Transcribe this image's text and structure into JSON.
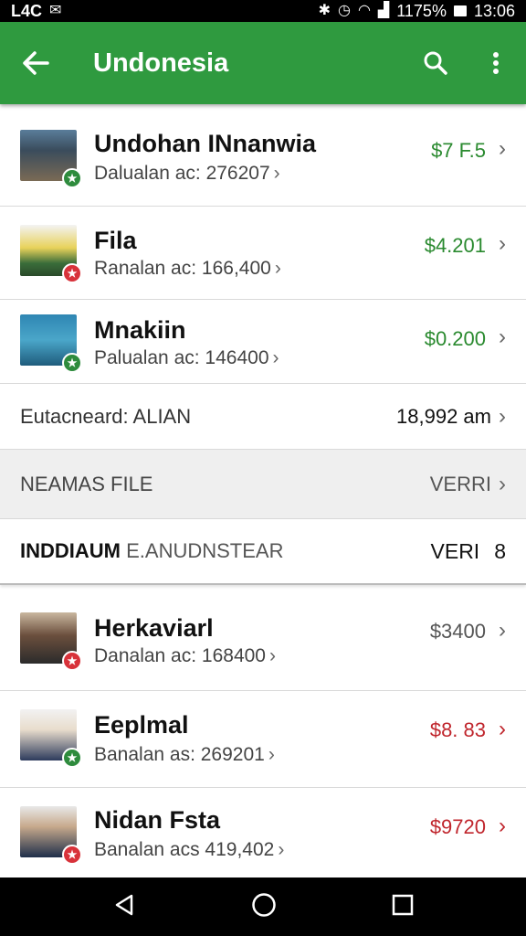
{
  "status_bar": {
    "carrier": "L4C",
    "signal": "1175%",
    "time": "13:06"
  },
  "app_bar": {
    "title": "Undonesia"
  },
  "items_top": [
    {
      "name": "Undohan INnanwia",
      "sub": "Dalualan ac: 276207",
      "price": "$7 F.5",
      "price_color": "#2a8a2f",
      "badge": "green"
    },
    {
      "name": "Fila",
      "sub": "Ranalan ac: 166,400",
      "price": "$4.201",
      "price_color": "#2a8a2f",
      "badge": "red"
    },
    {
      "name": "Mnakiin",
      "sub": "Palualan ac: 146400",
      "price": "$0.200",
      "price_color": "#2a8a2f",
      "badge": "green"
    }
  ],
  "summary_row": {
    "label": "Eutacneard: ALIAN",
    "value": "18,992 am"
  },
  "section1": {
    "label": "NEAMAS FILE",
    "value": "VERRI"
  },
  "section2": {
    "label_bold": "INDDIAUM",
    "label_rest": "E.ANUDNSTEAR",
    "value": "VERI",
    "count": "8"
  },
  "items_bottom": [
    {
      "name": "Herkaviarl",
      "sub": "Danalan ac: 168400",
      "price": "$3400",
      "price_color": "#555555",
      "badge": "red"
    },
    {
      "name": "Eeplmal",
      "sub": "Banalan as: 269201",
      "price": "$8. 83",
      "price_color": "#c0262d",
      "badge": "green"
    },
    {
      "name": "Nidan Fsta",
      "sub": "Banalan acs 419,402",
      "price": "$9720",
      "price_color": "#c0262d",
      "badge": "red"
    }
  ]
}
